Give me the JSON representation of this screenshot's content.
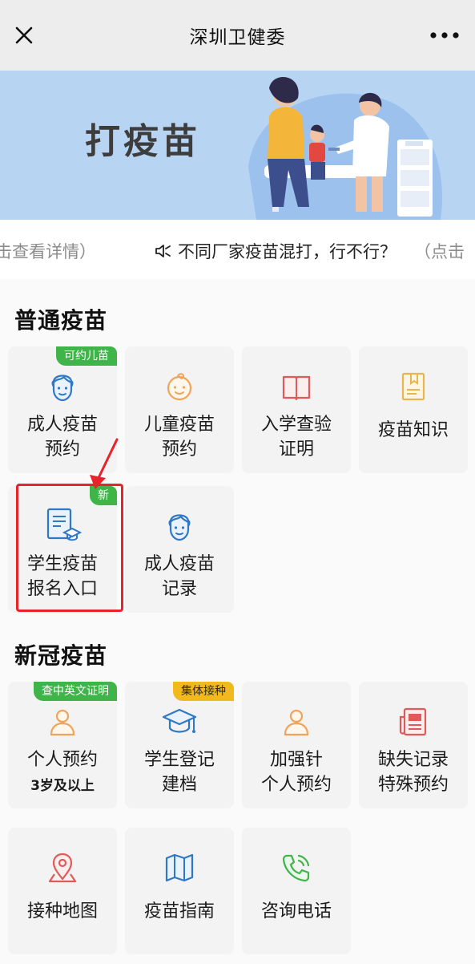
{
  "nav": {
    "title": "深圳卫健委",
    "close_icon": "close-icon",
    "more_icon": "more-dots-icon"
  },
  "banner": {
    "title": "打疫苗"
  },
  "notice": {
    "lead": "击查看详情）",
    "message": "不同厂家疫苗混打，行不行？",
    "tail": "（点击"
  },
  "sections": {
    "common": {
      "title": "普通疫苗",
      "tiles": [
        {
          "line1": "成人疫苗",
          "line2": "预约",
          "badge": "可约儿苗",
          "icon": "adult-face-icon",
          "color": "#2f78c8"
        },
        {
          "line1": "儿童疫苗",
          "line2": "预约",
          "icon": "child-face-icon",
          "color": "#f0a45b"
        },
        {
          "line1": "入学查验",
          "line2": "证明",
          "icon": "open-book-icon",
          "color": "#e05a5a"
        },
        {
          "line1": "疫苗知识",
          "icon": "bookmark-book-icon",
          "color": "#e8b64a"
        },
        {
          "line1": "学生疫苗",
          "line2": "报名入口",
          "badge": "新",
          "icon": "certificate-icon",
          "color": "#2f78c8"
        },
        {
          "line1": "成人疫苗",
          "line2": "记录",
          "icon": "adult-face-icon",
          "color": "#2f78c8"
        }
      ]
    },
    "covid": {
      "title": "新冠疫苗",
      "tiles": [
        {
          "line1": "个人预约",
          "sub": "3岁及以上",
          "badge": "查中英文证明",
          "icon": "person-icon",
          "color": "#f0a45b"
        },
        {
          "line1": "学生登记",
          "line2": "建档",
          "badge": "集体接种",
          "icon": "graduation-cap-icon",
          "color": "#2f78c8"
        },
        {
          "line1": "加强针",
          "line2": "个人预约",
          "icon": "person-icon",
          "color": "#f0a45b"
        },
        {
          "line1": "缺失记录",
          "line2": "特殊预约",
          "icon": "newspaper-icon",
          "color": "#e05a5a"
        },
        {
          "line1": "接种地图",
          "icon": "map-pin-icon",
          "color": "#e05a5a"
        },
        {
          "line1": "疫苗指南",
          "icon": "folded-map-icon",
          "color": "#2f78c8"
        },
        {
          "line1": "咨询电话",
          "icon": "phone-icon",
          "color": "#3fb549"
        }
      ]
    }
  },
  "highlight_color": "#e8232a"
}
